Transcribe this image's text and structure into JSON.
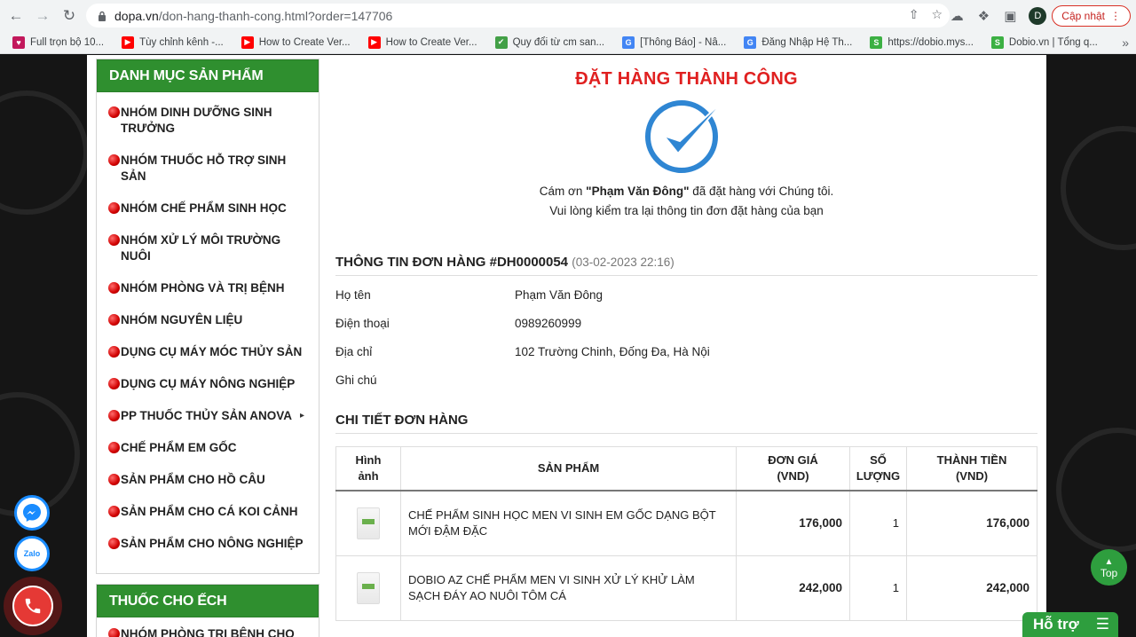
{
  "browser": {
    "url_domain": "dopa.vn",
    "url_path": "/don-hang-thanh-cong.html?order=147706",
    "update_label": "Cập nhật",
    "profile_initial": "D",
    "bookmarks": [
      {
        "label": "Full trọn bộ 10...",
        "icon": "heart-icon",
        "color": "#c2185b"
      },
      {
        "label": "Tùy chỉnh kênh -...",
        "icon": "youtube-icon",
        "color": "#ff0000"
      },
      {
        "label": "How to Create Ver...",
        "icon": "youtube-icon",
        "color": "#ff0000"
      },
      {
        "label": "How to Create Ver...",
        "icon": "youtube-icon",
        "color": "#ff0000"
      },
      {
        "label": "Quy đổi từ cm san...",
        "icon": "check-icon",
        "color": "#43a047"
      },
      {
        "label": "[Thông Báo] - Nâ...",
        "icon": "google-icon",
        "color": "#4285f4"
      },
      {
        "label": "Đăng Nhập Hệ Th...",
        "icon": "google-icon",
        "color": "#4285f4"
      },
      {
        "label": "https://dobio.mys...",
        "icon": "s-icon",
        "color": "#3cb043"
      },
      {
        "label": "Dobio.vn | Tổng q...",
        "icon": "s-icon",
        "color": "#3cb043"
      }
    ]
  },
  "sidebar": {
    "heading": "DANH MỤC SẢN PHẨM",
    "items": [
      {
        "label": "NHÓM DINH DƯỠNG SINH TRƯỞNG"
      },
      {
        "label": "NHÓM THUỐC HỖ TRỢ SINH SẢN"
      },
      {
        "label": "NHÓM CHẾ PHẨM SINH HỌC"
      },
      {
        "label": "NHÓM XỬ LÝ MÔI TRƯỜNG NUÔI"
      },
      {
        "label": "NHÓM PHÒNG VÀ TRỊ BỆNH"
      },
      {
        "label": "NHÓM NGUYÊN LIỆU"
      },
      {
        "label": "DỤNG CỤ MÁY MÓC THỦY SẢN"
      },
      {
        "label": "DỤNG CỤ MÁY NÔNG NGHIỆP"
      },
      {
        "label": "PP THUỐC THỦY SẢN ANOVA",
        "has_submenu": true
      },
      {
        "label": " CHẾ PHẨM EM GỐC"
      },
      {
        "label": " SẢN PHẨM CHO HỒ CÂU"
      },
      {
        "label": " SẢN PHẨM CHO CÁ KOI CẢNH"
      },
      {
        "label": " SẢN PHẨM CHO NÔNG NGHIỆP"
      }
    ],
    "heading2": "THUỐC CHO ẾCH",
    "items2": [
      {
        "label": "NHÓM PHÒNG TRỊ BỆNH CHO"
      }
    ]
  },
  "main": {
    "success_title": "ĐẶT HÀNG THÀNH CÔNG",
    "thanks_prefix": "Cám ơn ",
    "customer_quoted": "\"Phạm Văn Đông\"",
    "thanks_suffix": " đã đặt hàng với Chúng tôi.",
    "check_note": "Vui lòng kiểm tra lại thông tin đơn đặt hàng của bạn",
    "order_info_title": "THÔNG TIN ĐƠN HÀNG #DH0000054",
    "order_date": "(03-02-2023 22:16)",
    "info": [
      {
        "label": "Họ tên",
        "value": "Phạm Văn Đông"
      },
      {
        "label": "Điện thoại",
        "value": "0989260999"
      },
      {
        "label": "Địa chỉ",
        "value": "102 Trường Chinh, Đống Đa, Hà Nội"
      },
      {
        "label": "Ghi chú",
        "value": ""
      }
    ],
    "detail_title": "CHI TIẾT ĐƠN HÀNG",
    "table": {
      "headers": {
        "image_l1": "Hình",
        "image_l2": "ảnh",
        "product": "SẢN PHẨM",
        "price_l1": "ĐƠN GIÁ",
        "price_l2": "(VND)",
        "qty_l1": "SỐ",
        "qty_l2": "LƯỢNG",
        "total_l1": "THÀNH TIỀN",
        "total_l2": "(VND)"
      },
      "rows": [
        {
          "name": "CHẾ PHẨM SINH HỌC MEN VI SINH EM GỐC DẠNG BỘT MỚI ĐẬM ĐẶC",
          "price": "176,000",
          "qty": "1",
          "total": "176,000"
        },
        {
          "name": "DOBIO AZ CHẾ PHẨM MEN VI SINH XỬ LÝ KHỬ LÀM SẠCH ĐÁY AO NUÔI TÔM CÁ",
          "price": "242,000",
          "qty": "1",
          "total": "242,000"
        }
      ]
    }
  },
  "widgets": {
    "zalo_label": "Zalo",
    "top_label": "Top",
    "support_label": "Hỗ trợ"
  },
  "colors": {
    "accent_green": "#2f8f2f",
    "success_red": "#e02020",
    "price_red": "#c8102e",
    "check_blue": "#2f86d3"
  }
}
